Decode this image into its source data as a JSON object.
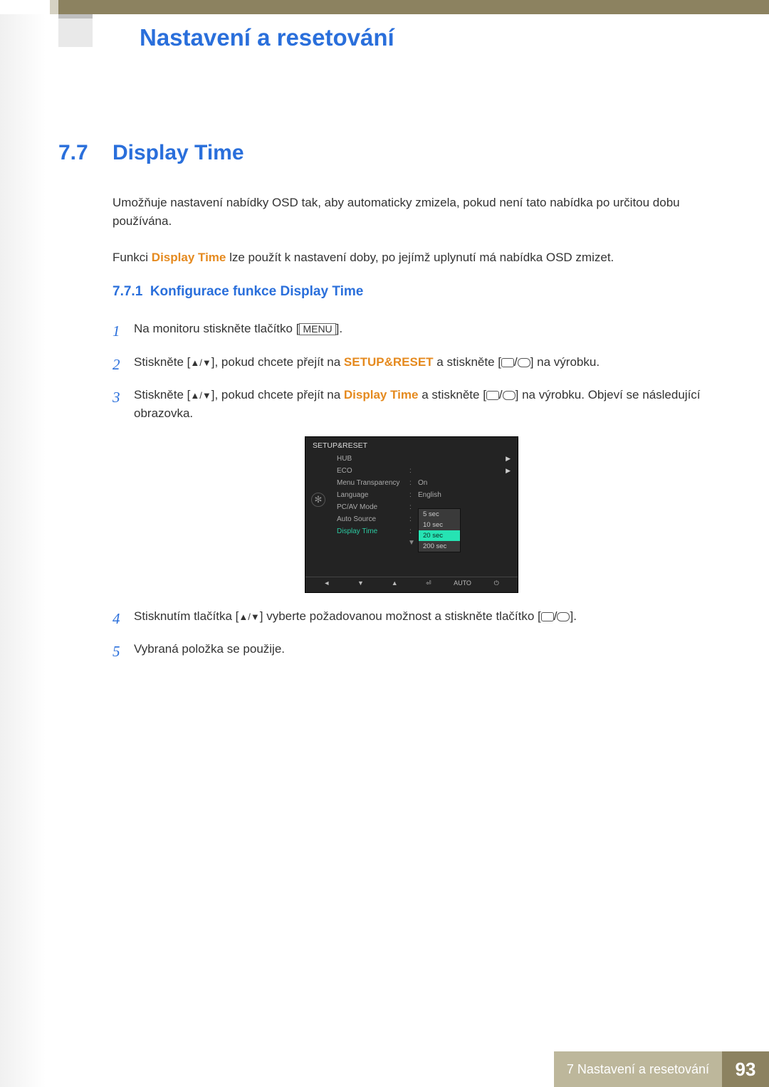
{
  "chapter": {
    "title": "Nastavení a resetování"
  },
  "section": {
    "number": "7.7",
    "title": "Display Time"
  },
  "intro": {
    "p1": "Umožňuje nastavení nabídky OSD tak, aby automaticky zmizela, pokud není tato nabídka po určitou dobu používána.",
    "p2_pre": "Funkci ",
    "p2_em": "Display Time",
    "p2_post": " lze použít k nastavení doby, po jejímž uplynutí má nabídka OSD zmizet."
  },
  "subsection": {
    "number": "7.7.1",
    "title": "Konfigurace funkce Display Time"
  },
  "steps": [
    {
      "n": "1",
      "pre": "Na monitoru stiskněte tlačítko [",
      "btn": "MENU",
      "post": "]."
    },
    {
      "n": "2",
      "pre": "Stiskněte [",
      "arrows": "▲/▼",
      "mid": "], pokud chcete přejít na ",
      "em": "SETUP&RESET",
      "aft": " a stiskněte [",
      "icons": true,
      "post": "] na výrobku."
    },
    {
      "n": "3",
      "pre": "Stiskněte [",
      "arrows": "▲/▼",
      "mid": "], pokud chcete přejít na ",
      "em": "Display Time",
      "aft": " a stiskněte [",
      "icons": true,
      "post": "] na výrobku. Objeví se následující obrazovka."
    },
    {
      "n": "4",
      "pre": "Stisknutím tlačítka [",
      "arrows": "▲/▼",
      "mid": "] vyberte požadovanou možnost a stiskněte tlačítko [",
      "icons": true,
      "post": "]."
    },
    {
      "n": "5",
      "pre": "Vybraná položka se použije."
    }
  ],
  "osd": {
    "header": "SETUP&RESET",
    "rows": [
      {
        "label": "HUB",
        "val": "",
        "arrow": "▶"
      },
      {
        "label": "ECO",
        "val": "",
        "colon": ":",
        "arrow": "▶"
      },
      {
        "label": "Menu Transparency",
        "val": "On",
        "colon": ":"
      },
      {
        "label": "Language",
        "val": "English",
        "colon": ":"
      },
      {
        "label": "PC/AV Mode",
        "val": "",
        "colon": ":"
      },
      {
        "label": "Auto Source",
        "val": "",
        "colon": ":"
      },
      {
        "label": "Display Time",
        "val": "",
        "colon": ":",
        "active": true
      }
    ],
    "options": [
      {
        "label": "5 sec"
      },
      {
        "label": "10 sec"
      },
      {
        "label": "20 sec",
        "selected": true
      },
      {
        "label": "200 sec"
      }
    ],
    "foot": [
      "◄",
      "▼",
      "▲",
      "",
      "AUTO",
      "◦"
    ]
  },
  "footer": {
    "label": "7 Nastavení a resetování",
    "page": "93"
  }
}
